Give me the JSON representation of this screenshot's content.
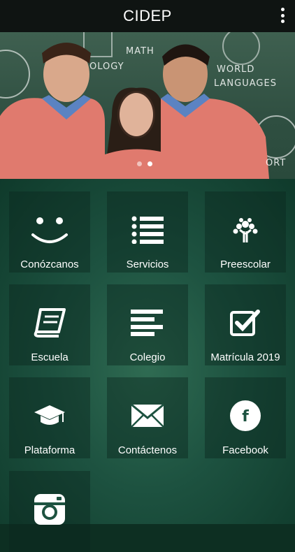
{
  "appbar": {
    "title": "CIDEP",
    "menu_icon": "overflow-menu-icon"
  },
  "banner": {
    "chalk_words": [
      "MATH",
      "OLOGY",
      "WORLD",
      "LANGUAGES",
      "ORT"
    ],
    "carousel": {
      "count": 2,
      "active": 2
    }
  },
  "tiles": [
    {
      "label": "Conózcanos",
      "icon": "smiley-icon"
    },
    {
      "label": "Servicios",
      "icon": "list-icon"
    },
    {
      "label": "Preescolar",
      "icon": "tree-icon"
    },
    {
      "label": "Escuela",
      "icon": "book-icon"
    },
    {
      "label": "Colegio",
      "icon": "align-left-icon"
    },
    {
      "label": "Matrícula 2019",
      "icon": "checkbox-icon"
    },
    {
      "label": "Plataforma",
      "icon": "graduation-cap-icon"
    },
    {
      "label": "Contáctenos",
      "icon": "envelope-icon"
    },
    {
      "label": "Facebook",
      "icon": "facebook-icon"
    },
    {
      "label": "",
      "icon": "instagram-icon"
    }
  ],
  "colors": {
    "appbar": "#0f1412",
    "board": "#1d5240",
    "shirt": "#e07a6e"
  }
}
